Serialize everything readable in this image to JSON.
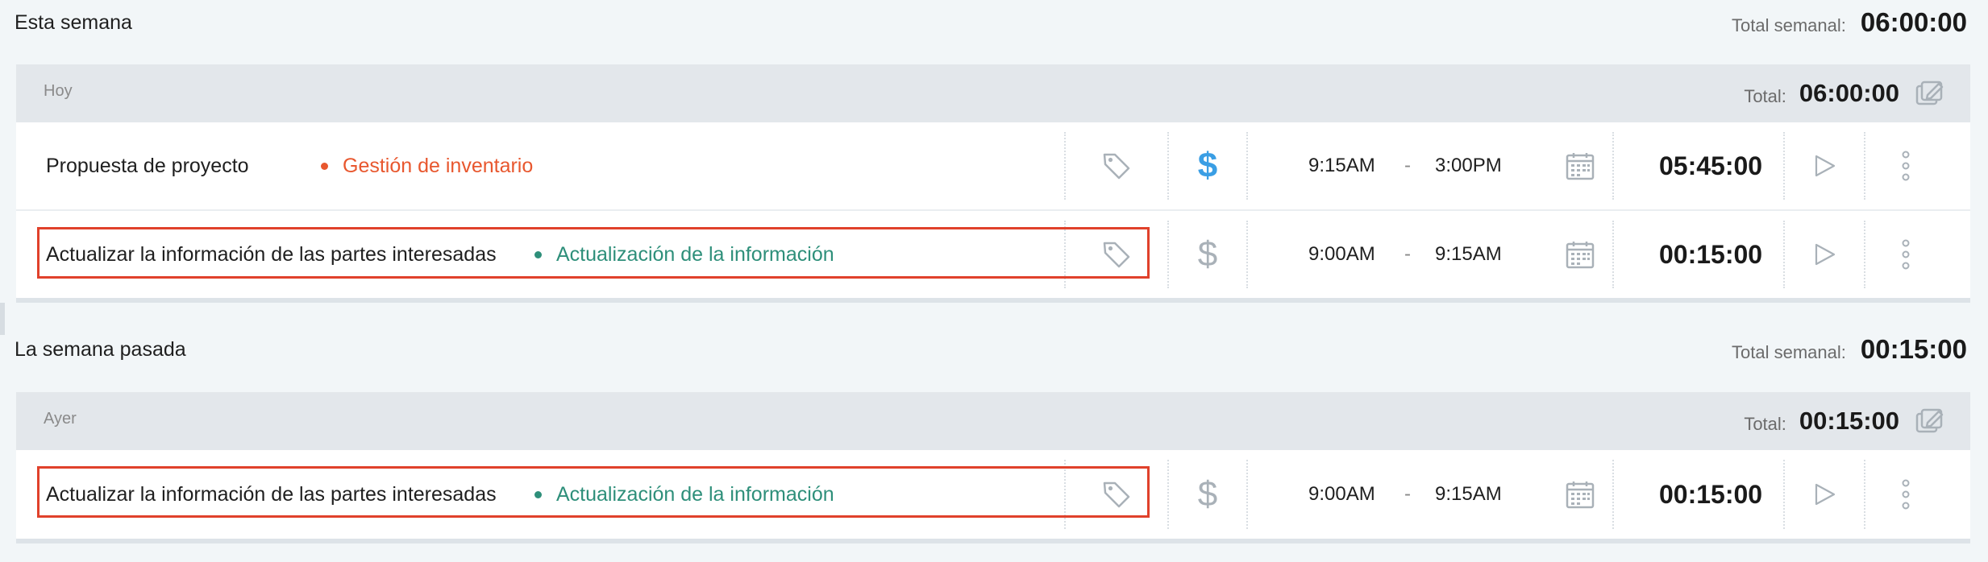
{
  "weeks": [
    {
      "title": "Esta semana",
      "total_label": "Total semanal:",
      "total_value": "06:00:00",
      "days": [
        {
          "label": "Hoy",
          "total_label": "Total:",
          "total_value": "06:00:00",
          "entries": [
            {
              "description": "Propuesta de proyecto",
              "project": "Gestión de inventario",
              "project_color": "#e8572e",
              "billable": true,
              "start": "9:15AM",
              "separator": "-",
              "end": "3:00PM",
              "duration": "05:45:00",
              "highlighted": false
            },
            {
              "description": "Actualizar la información de las partes interesadas",
              "project": "Actualización de la información",
              "project_color": "#2e8f7a",
              "billable": false,
              "start": "9:00AM",
              "separator": "-",
              "end": "9:15AM",
              "duration": "00:15:00",
              "highlighted": true
            }
          ]
        }
      ]
    },
    {
      "title": "La semana pasada",
      "total_label": "Total semanal:",
      "total_value": "00:15:00",
      "days": [
        {
          "label": "Ayer",
          "total_label": "Total:",
          "total_value": "00:15:00",
          "entries": [
            {
              "description": "Actualizar la información de las partes interesadas",
              "project": "Actualización de la información",
              "project_color": "#2e8f7a",
              "billable": false,
              "start": "9:00AM",
              "separator": "-",
              "end": "9:15AM",
              "duration": "00:15:00",
              "highlighted": true
            }
          ]
        }
      ]
    }
  ],
  "colors": {
    "billable_active": "#3a9ee4",
    "icon_inactive": "#a9b1b8",
    "highlight_border": "#e0412b"
  },
  "icons": [
    "tag-icon",
    "dollar-icon",
    "calendar-icon",
    "play-icon",
    "more-vertical-icon",
    "bulk-edit-icon"
  ]
}
